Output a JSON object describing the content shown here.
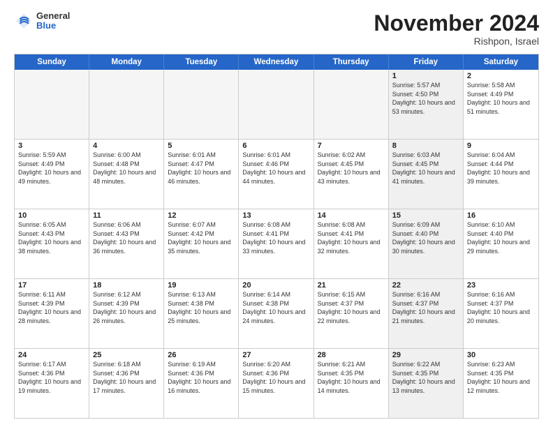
{
  "header": {
    "logo": {
      "general": "General",
      "blue": "Blue"
    },
    "title": "November 2024",
    "location": "Rishpon, Israel"
  },
  "calendar": {
    "days_of_week": [
      "Sunday",
      "Monday",
      "Tuesday",
      "Wednesday",
      "Thursday",
      "Friday",
      "Saturday"
    ],
    "rows": [
      [
        {
          "day": "",
          "empty": true
        },
        {
          "day": "",
          "empty": true
        },
        {
          "day": "",
          "empty": true
        },
        {
          "day": "",
          "empty": true
        },
        {
          "day": "",
          "empty": true
        },
        {
          "day": "1",
          "sunrise": "Sunrise: 5:57 AM",
          "sunset": "Sunset: 4:50 PM",
          "daylight": "Daylight: 10 hours and 53 minutes.",
          "shaded": true
        },
        {
          "day": "2",
          "sunrise": "Sunrise: 5:58 AM",
          "sunset": "Sunset: 4:49 PM",
          "daylight": "Daylight: 10 hours and 51 minutes.",
          "shaded": false
        }
      ],
      [
        {
          "day": "3",
          "sunrise": "Sunrise: 5:59 AM",
          "sunset": "Sunset: 4:49 PM",
          "daylight": "Daylight: 10 hours and 49 minutes.",
          "shaded": false
        },
        {
          "day": "4",
          "sunrise": "Sunrise: 6:00 AM",
          "sunset": "Sunset: 4:48 PM",
          "daylight": "Daylight: 10 hours and 48 minutes.",
          "shaded": false
        },
        {
          "day": "5",
          "sunrise": "Sunrise: 6:01 AM",
          "sunset": "Sunset: 4:47 PM",
          "daylight": "Daylight: 10 hours and 46 minutes.",
          "shaded": false
        },
        {
          "day": "6",
          "sunrise": "Sunrise: 6:01 AM",
          "sunset": "Sunset: 4:46 PM",
          "daylight": "Daylight: 10 hours and 44 minutes.",
          "shaded": false
        },
        {
          "day": "7",
          "sunrise": "Sunrise: 6:02 AM",
          "sunset": "Sunset: 4:45 PM",
          "daylight": "Daylight: 10 hours and 43 minutes.",
          "shaded": false
        },
        {
          "day": "8",
          "sunrise": "Sunrise: 6:03 AM",
          "sunset": "Sunset: 4:45 PM",
          "daylight": "Daylight: 10 hours and 41 minutes.",
          "shaded": true
        },
        {
          "day": "9",
          "sunrise": "Sunrise: 6:04 AM",
          "sunset": "Sunset: 4:44 PM",
          "daylight": "Daylight: 10 hours and 39 minutes.",
          "shaded": false
        }
      ],
      [
        {
          "day": "10",
          "sunrise": "Sunrise: 6:05 AM",
          "sunset": "Sunset: 4:43 PM",
          "daylight": "Daylight: 10 hours and 38 minutes.",
          "shaded": false
        },
        {
          "day": "11",
          "sunrise": "Sunrise: 6:06 AM",
          "sunset": "Sunset: 4:43 PM",
          "daylight": "Daylight: 10 hours and 36 minutes.",
          "shaded": false
        },
        {
          "day": "12",
          "sunrise": "Sunrise: 6:07 AM",
          "sunset": "Sunset: 4:42 PM",
          "daylight": "Daylight: 10 hours and 35 minutes.",
          "shaded": false
        },
        {
          "day": "13",
          "sunrise": "Sunrise: 6:08 AM",
          "sunset": "Sunset: 4:41 PM",
          "daylight": "Daylight: 10 hours and 33 minutes.",
          "shaded": false
        },
        {
          "day": "14",
          "sunrise": "Sunrise: 6:08 AM",
          "sunset": "Sunset: 4:41 PM",
          "daylight": "Daylight: 10 hours and 32 minutes.",
          "shaded": false
        },
        {
          "day": "15",
          "sunrise": "Sunrise: 6:09 AM",
          "sunset": "Sunset: 4:40 PM",
          "daylight": "Daylight: 10 hours and 30 minutes.",
          "shaded": true
        },
        {
          "day": "16",
          "sunrise": "Sunrise: 6:10 AM",
          "sunset": "Sunset: 4:40 PM",
          "daylight": "Daylight: 10 hours and 29 minutes.",
          "shaded": false
        }
      ],
      [
        {
          "day": "17",
          "sunrise": "Sunrise: 6:11 AM",
          "sunset": "Sunset: 4:39 PM",
          "daylight": "Daylight: 10 hours and 28 minutes.",
          "shaded": false
        },
        {
          "day": "18",
          "sunrise": "Sunrise: 6:12 AM",
          "sunset": "Sunset: 4:39 PM",
          "daylight": "Daylight: 10 hours and 26 minutes.",
          "shaded": false
        },
        {
          "day": "19",
          "sunrise": "Sunrise: 6:13 AM",
          "sunset": "Sunset: 4:38 PM",
          "daylight": "Daylight: 10 hours and 25 minutes.",
          "shaded": false
        },
        {
          "day": "20",
          "sunrise": "Sunrise: 6:14 AM",
          "sunset": "Sunset: 4:38 PM",
          "daylight": "Daylight: 10 hours and 24 minutes.",
          "shaded": false
        },
        {
          "day": "21",
          "sunrise": "Sunrise: 6:15 AM",
          "sunset": "Sunset: 4:37 PM",
          "daylight": "Daylight: 10 hours and 22 minutes.",
          "shaded": false
        },
        {
          "day": "22",
          "sunrise": "Sunrise: 6:16 AM",
          "sunset": "Sunset: 4:37 PM",
          "daylight": "Daylight: 10 hours and 21 minutes.",
          "shaded": true
        },
        {
          "day": "23",
          "sunrise": "Sunrise: 6:16 AM",
          "sunset": "Sunset: 4:37 PM",
          "daylight": "Daylight: 10 hours and 20 minutes.",
          "shaded": false
        }
      ],
      [
        {
          "day": "24",
          "sunrise": "Sunrise: 6:17 AM",
          "sunset": "Sunset: 4:36 PM",
          "daylight": "Daylight: 10 hours and 19 minutes.",
          "shaded": false
        },
        {
          "day": "25",
          "sunrise": "Sunrise: 6:18 AM",
          "sunset": "Sunset: 4:36 PM",
          "daylight": "Daylight: 10 hours and 17 minutes.",
          "shaded": false
        },
        {
          "day": "26",
          "sunrise": "Sunrise: 6:19 AM",
          "sunset": "Sunset: 4:36 PM",
          "daylight": "Daylight: 10 hours and 16 minutes.",
          "shaded": false
        },
        {
          "day": "27",
          "sunrise": "Sunrise: 6:20 AM",
          "sunset": "Sunset: 4:36 PM",
          "daylight": "Daylight: 10 hours and 15 minutes.",
          "shaded": false
        },
        {
          "day": "28",
          "sunrise": "Sunrise: 6:21 AM",
          "sunset": "Sunset: 4:35 PM",
          "daylight": "Daylight: 10 hours and 14 minutes.",
          "shaded": false
        },
        {
          "day": "29",
          "sunrise": "Sunrise: 6:22 AM",
          "sunset": "Sunset: 4:35 PM",
          "daylight": "Daylight: 10 hours and 13 minutes.",
          "shaded": true
        },
        {
          "day": "30",
          "sunrise": "Sunrise: 6:23 AM",
          "sunset": "Sunset: 4:35 PM",
          "daylight": "Daylight: 10 hours and 12 minutes.",
          "shaded": false
        }
      ]
    ]
  }
}
